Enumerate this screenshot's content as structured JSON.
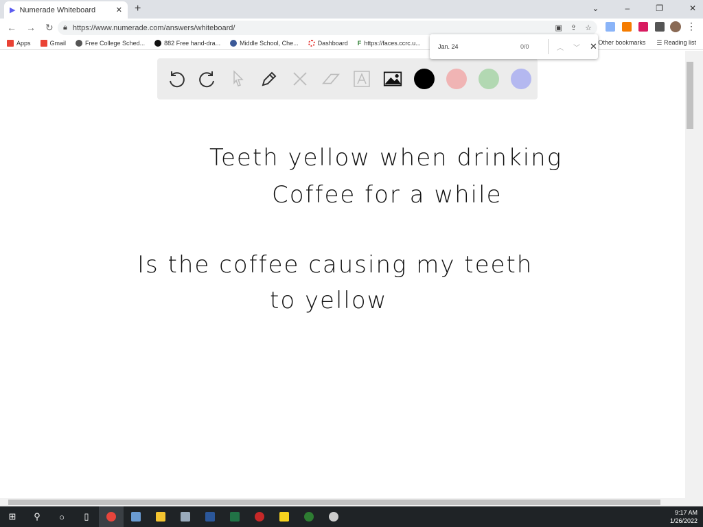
{
  "browser": {
    "tab_title": "Numerade Whiteboard",
    "url": "https://www.numerade.com/answers/whiteboard/"
  },
  "bookmarks": [
    {
      "label": "Apps",
      "color": "#e94235"
    },
    {
      "label": "Gmail",
      "color": "#ea4335"
    },
    {
      "label": "Free College Sched...",
      "color": "#555555"
    },
    {
      "label": "882 Free hand-dra...",
      "color": "#111111"
    },
    {
      "label": "Middle School, Che...",
      "color": "#3b5998"
    },
    {
      "label": "Dashboard",
      "color": "#e53935"
    },
    {
      "label": "https://faces.ccrc.u...",
      "color": "#2e7d32"
    }
  ],
  "bookmarks_right": {
    "other": "Other bookmarks",
    "reading": "Reading list"
  },
  "find": {
    "query": "Jan. 24",
    "count": "0/0"
  },
  "toolbar": {
    "tools": [
      "undo-icon",
      "redo-icon",
      "pointer-icon",
      "pen-icon",
      "tools-icon",
      "eraser-icon",
      "text-icon",
      "image-icon"
    ],
    "colors": [
      "#000000",
      "#f0b4b4",
      "#b2d8b2",
      "#b4b8f0"
    ]
  },
  "whiteboard": {
    "lines": [
      "Teeth yellow when drinking",
      "Coffee for a while",
      "Is the coffee causing my teeth",
      "to yellow"
    ]
  },
  "taskbar": {
    "time": "9:17 AM",
    "date": "1/26/2022"
  }
}
